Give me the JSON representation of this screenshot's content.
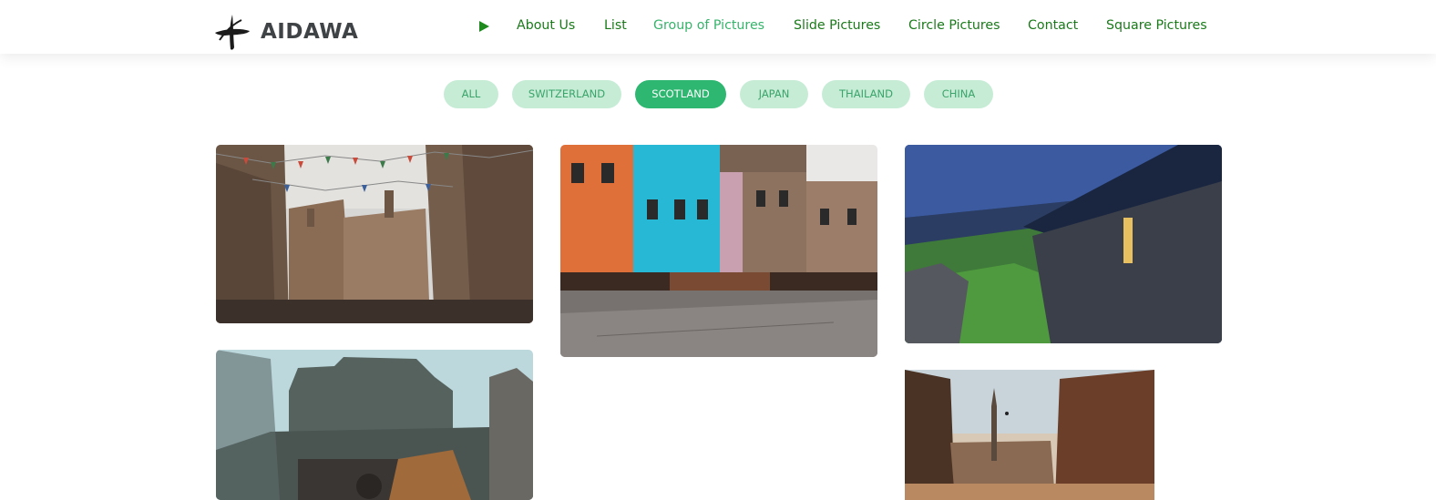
{
  "brand": {
    "name": "AIDAWA"
  },
  "nav": {
    "items": [
      {
        "label": "About Us"
      },
      {
        "label": "List"
      },
      {
        "label": "Group of Pictures",
        "active": true
      },
      {
        "label": "Slide Pictures"
      },
      {
        "label": "Circle Pictures"
      },
      {
        "label": "Contact"
      },
      {
        "label": "Square Pictures"
      }
    ]
  },
  "filters": {
    "items": [
      {
        "label": "ALL"
      },
      {
        "label": "SWITZERLAND"
      },
      {
        "label": "SCOTLAND",
        "active": true
      },
      {
        "label": "JAPAN"
      },
      {
        "label": "THAILAND"
      },
      {
        "label": "CHINA"
      }
    ]
  },
  "gallery": {
    "images": [
      {
        "name": "old-town-street-bunting"
      },
      {
        "name": "colorful-victoria-street"
      },
      {
        "name": "stone-cottages-hillside"
      },
      {
        "name": "castle-on-hill-misty"
      },
      {
        "name": "royal-mile-sunset"
      }
    ]
  },
  "colors": {
    "nav_text": "#1a7a1a",
    "nav_active": "#37b36b",
    "pill_bg": "#c6ecd6",
    "pill_text": "#3aa46a",
    "pill_active_bg": "#2eb770"
  }
}
